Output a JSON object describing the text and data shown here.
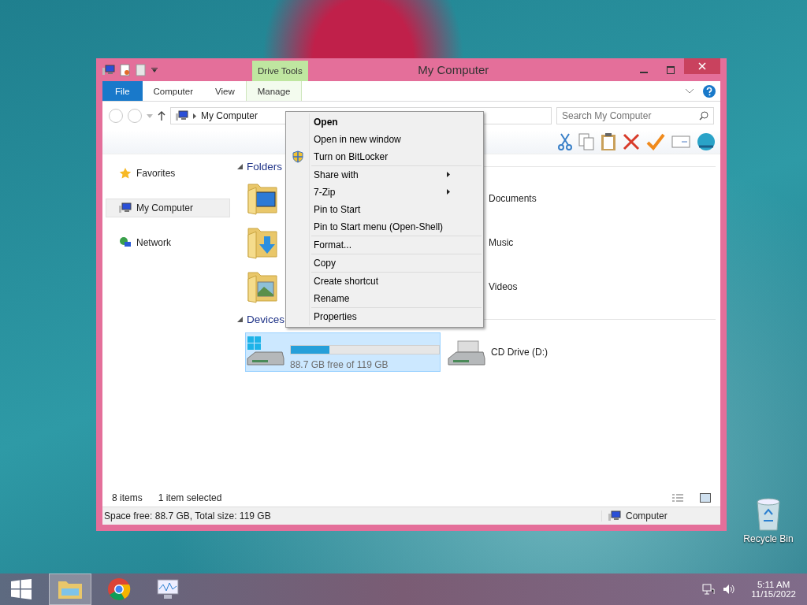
{
  "window": {
    "title": "My Computer",
    "contextual_group": "Drive Tools",
    "tabs": [
      {
        "label": "File",
        "kind": "file",
        "selected": false
      },
      {
        "label": "Computer",
        "kind": "tab",
        "selected": false
      },
      {
        "label": "View",
        "kind": "tab",
        "selected": false
      },
      {
        "label": "Manage",
        "kind": "contextual",
        "selected": false
      }
    ]
  },
  "address": {
    "path": "My Computer"
  },
  "search": {
    "placeholder": "Search My Computer"
  },
  "sidebar": {
    "items": [
      {
        "label": "Favorites",
        "kind": "star",
        "selected": false
      },
      {
        "label": "My Computer",
        "kind": "computer",
        "selected": true
      },
      {
        "label": "Network",
        "kind": "network",
        "selected": false
      }
    ]
  },
  "folders": {
    "title": "Folders",
    "expanded": true,
    "items": [
      {
        "kind": "desktop"
      },
      {
        "label": "Documents",
        "kind": "documents"
      },
      {
        "kind": "downloads"
      },
      {
        "label": "Music",
        "kind": "music"
      },
      {
        "kind": "pictures"
      },
      {
        "label": "Videos",
        "kind": "videos"
      }
    ]
  },
  "devices": {
    "title": "Devices",
    "expanded": true,
    "items": [
      {
        "kind": "hdd",
        "selected": true,
        "level": 0.26,
        "free": "88.7 GB free of 119 GB"
      },
      {
        "kind": "cd",
        "selected": false,
        "label": "CD Drive (D:)"
      }
    ]
  },
  "context_menu": {
    "groups": [
      [
        {
          "label": "Open",
          "default": true
        },
        {
          "label": "Open in new window",
          "default": false
        },
        {
          "label": "Turn on BitLocker",
          "default": false,
          "kind": "shield"
        }
      ],
      [
        {
          "label": "Share with",
          "default": false,
          "submenu": true
        },
        {
          "label": "7-Zip",
          "default": false,
          "submenu": true
        },
        {
          "label": "Pin to Start",
          "default": false
        },
        {
          "label": "Pin to Start menu (Open-Shell)",
          "default": false
        }
      ],
      [
        {
          "label": "Format...",
          "default": false
        }
      ],
      [
        {
          "label": "Copy",
          "default": false
        }
      ],
      [
        {
          "label": "Create shortcut",
          "default": false
        },
        {
          "label": "Rename",
          "default": false
        }
      ],
      [
        {
          "label": "Properties",
          "default": false
        }
      ]
    ]
  },
  "status": {
    "count": "8 items",
    "selection": "1 item selected"
  },
  "status_bar": {
    "info": "Space free: 88.7 GB, Total size: 119 GB",
    "location": "Computer"
  },
  "desktop_icons": [
    {
      "label": "Recycle Bin"
    }
  ],
  "taskbar": {
    "apps": [
      {
        "kind": "explorer",
        "active": true
      },
      {
        "kind": "chrome",
        "active": false
      },
      {
        "kind": "monitor",
        "active": false
      }
    ],
    "time": "5:11 AM",
    "date": "11/15/2022"
  }
}
